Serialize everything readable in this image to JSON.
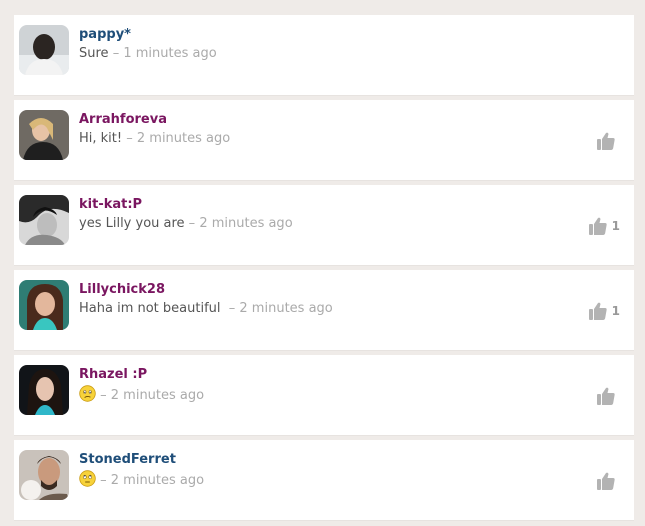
{
  "colors": {
    "page_bg": "#efebe8",
    "card_bg": "#ffffff",
    "name_blue": "#1f4e79",
    "name_purple": "#7a1660",
    "time_grey": "#aaaaaa",
    "like_grey": "#b3b3b3"
  },
  "comments": [
    {
      "username": "pappy*",
      "name_color": "blue",
      "message": "Sure",
      "separator": " – ",
      "time": "1 minutes ago",
      "emoji": null,
      "like_icon": "thumbs-up-icon",
      "like_visible": false,
      "likes": ""
    },
    {
      "username": "Arrahforeva",
      "name_color": "purple",
      "message": "Hi, kit!",
      "separator": " – ",
      "time": "2 minutes ago",
      "emoji": null,
      "like_icon": "thumbs-up-icon",
      "like_visible": true,
      "likes": ""
    },
    {
      "username": "kit-kat:P",
      "name_color": "purple",
      "message": "yes Lilly you are",
      "separator": " – ",
      "time": "2 minutes ago",
      "emoji": null,
      "like_icon": "thumbs-up-icon",
      "like_visible": true,
      "likes": "1"
    },
    {
      "username": "Lillychick28",
      "name_color": "purple",
      "message": "Haha im not beautiful ",
      "separator": " – ",
      "time": "2 minutes ago",
      "emoji": null,
      "like_icon": "thumbs-up-icon",
      "like_visible": true,
      "likes": "1"
    },
    {
      "username": "Rhazel :P",
      "name_color": "purple",
      "message": "",
      "separator": " – ",
      "time": "2 minutes ago",
      "emoji": "worried-face-emoji",
      "like_icon": "thumbs-up-icon",
      "like_visible": true,
      "likes": ""
    },
    {
      "username": "StonedFerret",
      "name_color": "blue",
      "message": "",
      "separator": " – ",
      "time": "2 minutes ago",
      "emoji": "eye-roll-face-emoji",
      "like_icon": "thumbs-up-icon",
      "like_visible": true,
      "likes": ""
    }
  ]
}
